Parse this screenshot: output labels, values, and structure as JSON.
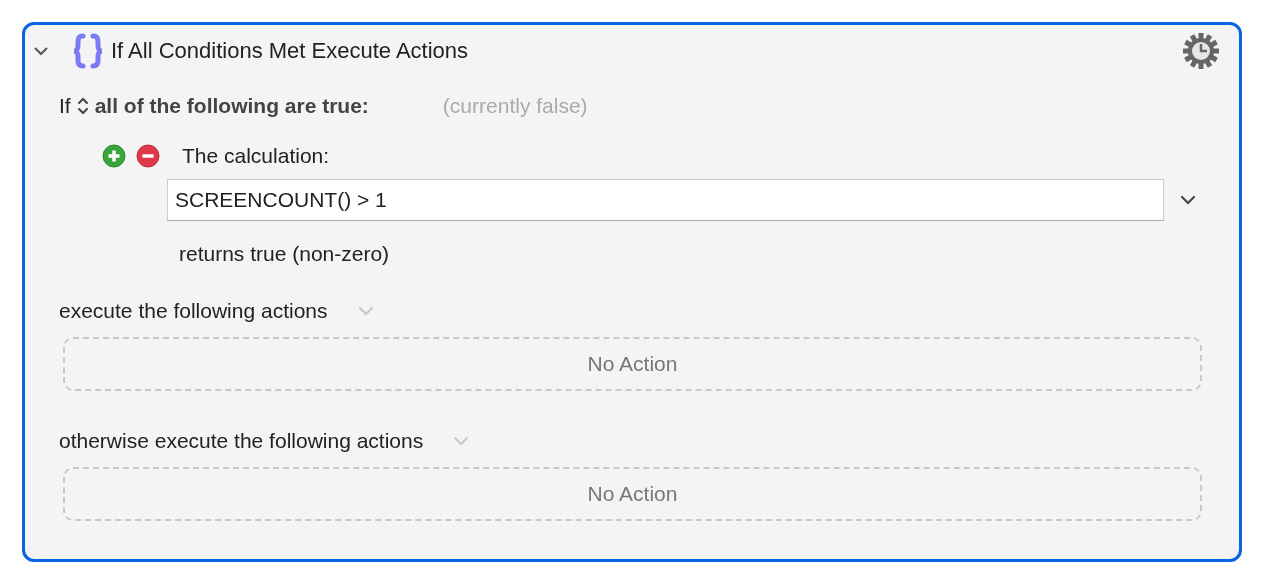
{
  "action": {
    "title": "If All Conditions Met Execute Actions",
    "expanded": true,
    "selected": true
  },
  "condition": {
    "prefix": "If",
    "mode": "all of the following are true:",
    "status": "(currently false)"
  },
  "conditions": [
    {
      "label": "The calculation:",
      "value": "SCREENCOUNT() > 1",
      "result": "returns true (non-zero)"
    }
  ],
  "branches": [
    {
      "label": "execute the following actions",
      "empty_text": "No Action"
    },
    {
      "label": "otherwise execute the following actions",
      "empty_text": "No Action"
    }
  ]
}
